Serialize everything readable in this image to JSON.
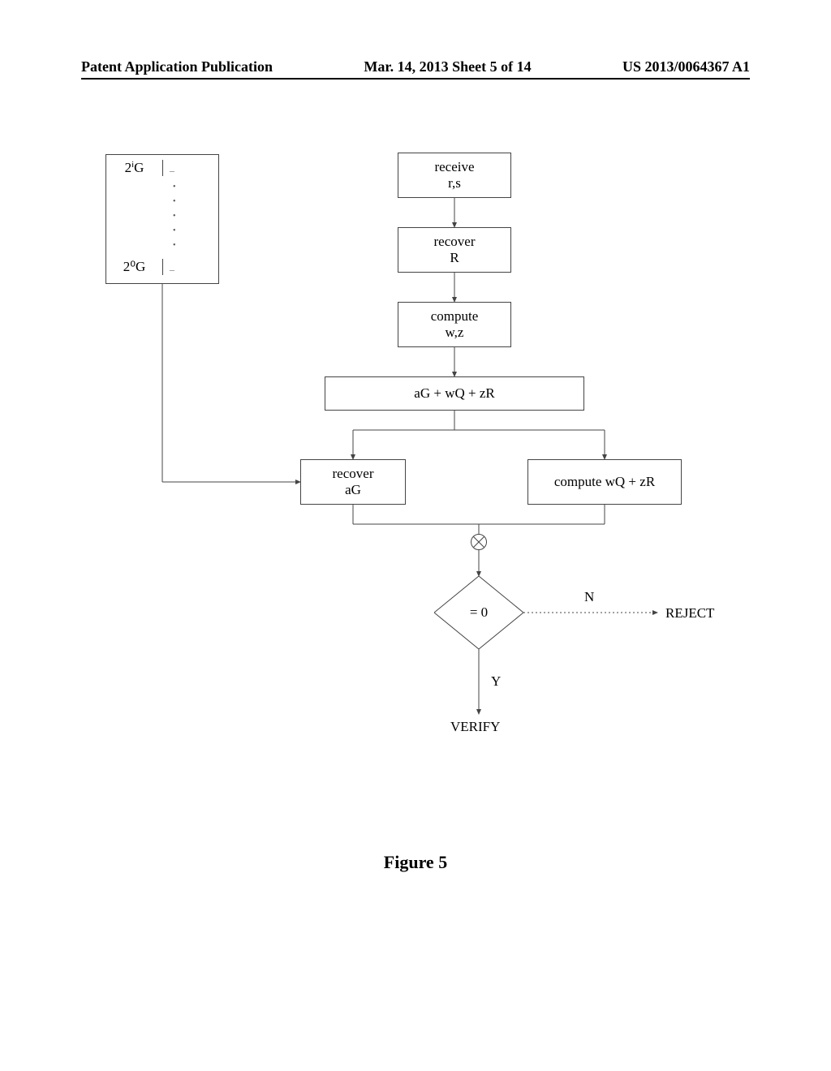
{
  "header": {
    "left": "Patent Application Publication",
    "center": "Mar. 14, 2013  Sheet 5 of 14",
    "right": "US 2013/0064367 A1"
  },
  "table": {
    "row_top": "2ⁱG",
    "row_bottom": "2⁰G"
  },
  "steps": {
    "receive": "receive\nr,s",
    "recover_R": "recover\nR",
    "compute_wz": "compute\nw,z",
    "sum_expr": "aG + wQ + zR",
    "recover_aG": "recover\naG",
    "compute_wQzR": "compute wQ + zR",
    "decision": "= 0",
    "yes_label": "Y",
    "no_label": "N",
    "verify": "VERIFY",
    "reject": "REJECT"
  },
  "figure_label": "Figure 5"
}
